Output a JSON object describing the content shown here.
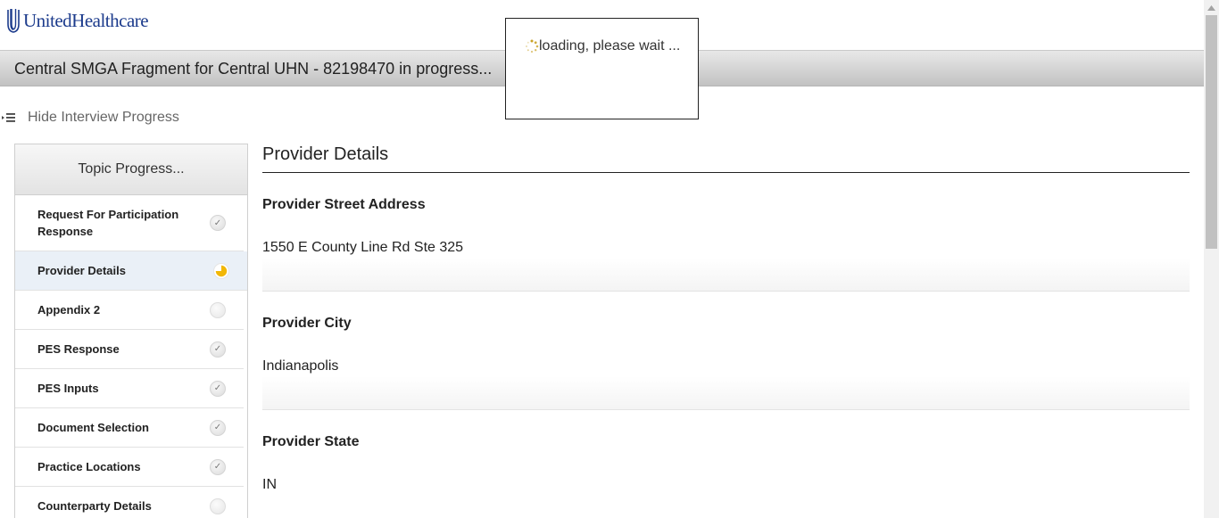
{
  "brand": {
    "name": "UnitedHealthcare"
  },
  "titlebar": {
    "title": "Central SMGA Fragment for Central UHN - 82198470 in progress..."
  },
  "sidebar_toggle": {
    "label": "Hide Interview Progress",
    "icon": "menu-collapse-icon"
  },
  "topic_progress": {
    "header": "Topic Progress...",
    "items": [
      {
        "label": "Request For Participation Response",
        "status": "complete"
      },
      {
        "label": "Provider Details",
        "status": "in-progress"
      },
      {
        "label": "Appendix 2",
        "status": "not-started"
      },
      {
        "label": "PES Response",
        "status": "complete"
      },
      {
        "label": "PES Inputs",
        "status": "complete"
      },
      {
        "label": "Document Selection",
        "status": "complete"
      },
      {
        "label": "Practice Locations",
        "status": "complete"
      },
      {
        "label": "Counterparty Details",
        "status": "not-started"
      }
    ]
  },
  "main": {
    "section_title": "Provider Details",
    "fields": [
      {
        "label": "Provider Street Address",
        "value": "1550 E County Line Rd Ste 325"
      },
      {
        "label": "Provider City",
        "value": "Indianapolis"
      },
      {
        "label": "Provider State",
        "value": "IN"
      }
    ]
  },
  "loading": {
    "text": "loading, please wait ..."
  },
  "colors": {
    "brand_blue": "#1c3b8c",
    "progress_yellow": "#f2b705",
    "active_row": "#eaf0f7"
  }
}
